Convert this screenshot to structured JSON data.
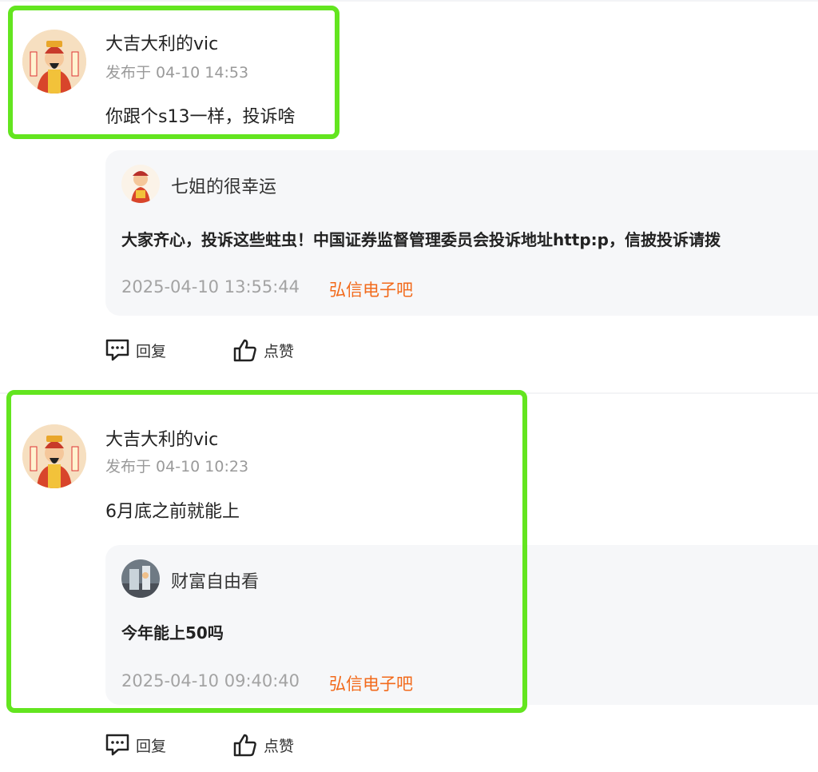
{
  "posts": [
    {
      "author": "大吉大利的vic",
      "meta": "发布于 04-10 14:53",
      "content": "你跟个s13一样，投诉啥",
      "quote": {
        "name": "七姐的很幸运",
        "text": "大家齐心，投诉这些蛀虫！中国证券监督管理委员会投诉地址http:p，信披投诉请拨",
        "time": "2025-04-10 13:55:44",
        "bar": "弘信电子吧"
      },
      "actions": {
        "reply": "回复",
        "like": "点赞"
      }
    },
    {
      "author": "大吉大利的vic",
      "meta": "发布于 04-10 10:23",
      "content": "6月底之前就能上",
      "quote": {
        "name": "财富自由看",
        "text": "今年能上50吗",
        "time": "2025-04-10 09:40:40",
        "bar": "弘信电子吧"
      },
      "actions": {
        "reply": "回复",
        "like": "点赞"
      }
    }
  ],
  "colors": {
    "highlight": "#63e51f",
    "bar_link": "#f26a1b",
    "quote_bg": "#f6f7f9",
    "meta": "#9a9a9a"
  },
  "icons": {
    "reply": "comment-icon",
    "like": "thumbs-up-icon"
  }
}
